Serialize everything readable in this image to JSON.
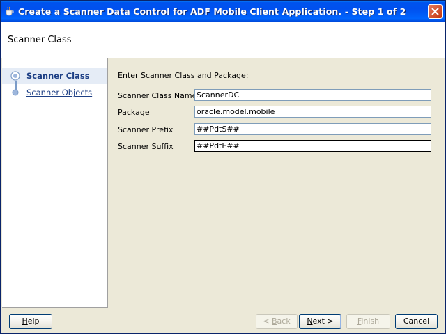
{
  "window": {
    "title": "Create a Scanner Data Control for ADF Mobile Client Application. - Step 1 of 2",
    "icon": "oracle-jdeveloper-icon"
  },
  "header": {
    "step_title": "Scanner Class"
  },
  "nav": {
    "items": [
      {
        "label": "Scanner Class",
        "state": "active"
      },
      {
        "label": "Scanner Objects",
        "state": "link"
      }
    ]
  },
  "form": {
    "intro": "Enter Scanner Class and Package:",
    "fields": [
      {
        "label": "Scanner Class Name",
        "value": "ScannerDC"
      },
      {
        "label": "Package",
        "value": "oracle.model.mobile"
      },
      {
        "label": "Scanner Prefix",
        "value": "##PdtS##"
      },
      {
        "label": "Scanner Suffix",
        "value": "##PdtE##"
      }
    ]
  },
  "buttons": {
    "help": {
      "pre": "",
      "mnemonic": "H",
      "post": "elp"
    },
    "back": {
      "pre": "< ",
      "mnemonic": "B",
      "post": "ack"
    },
    "next": {
      "pre": "",
      "mnemonic": "N",
      "post": "ext >"
    },
    "finish": {
      "pre": "",
      "mnemonic": "F",
      "post": "inish"
    },
    "cancel": {
      "pre": "Cancel",
      "mnemonic": "",
      "post": ""
    }
  },
  "colors": {
    "titlebar": "#0054e3",
    "nav_active_text": "#1d3f85",
    "dialog_bg": "#ece9d8"
  }
}
